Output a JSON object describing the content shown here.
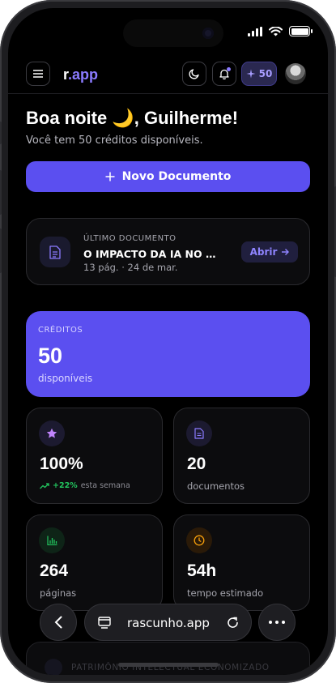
{
  "app": {
    "logo_prefix": "r",
    "logo_dot": ".",
    "logo_suffix": "app",
    "credits_badge": "50"
  },
  "greeting": {
    "title": "Boa noite 🌙, Guilherme!",
    "subtitle": "Você tem 50 créditos disponíveis."
  },
  "new_document": {
    "label": "Novo Documento"
  },
  "last_document": {
    "label": "ÚLTIMO DOCUMENTO",
    "title": "O IMPACTO DA IA NO MEIO AMBIENTE",
    "meta": "13 pág. · 24 de mar.",
    "open_label": "Abrir"
  },
  "credits_card": {
    "label": "CRÉDITOS",
    "value": "50",
    "sub": "disponíveis"
  },
  "stats": [
    {
      "value": "100%",
      "trend": "+22%",
      "trend_label": "esta semana",
      "icon": "star-icon"
    },
    {
      "value": "20",
      "label": "documentos",
      "icon": "document-icon"
    },
    {
      "value": "264",
      "label": "páginas",
      "icon": "bar-chart-icon"
    },
    {
      "value": "54h",
      "label": "tempo estimado",
      "icon": "clock-icon"
    }
  ],
  "browser": {
    "url": "rascunho.app"
  },
  "peek_card": {
    "label": "PATRIMÔNIO INTELECTUAL ECONOMIZADO"
  },
  "colors": {
    "accent": "#5b4ff0",
    "accent_text": "#8b7bff",
    "positive": "#22c55e",
    "star": "#c084fc",
    "chart": "#22c55e",
    "clock": "#f59e0b"
  }
}
